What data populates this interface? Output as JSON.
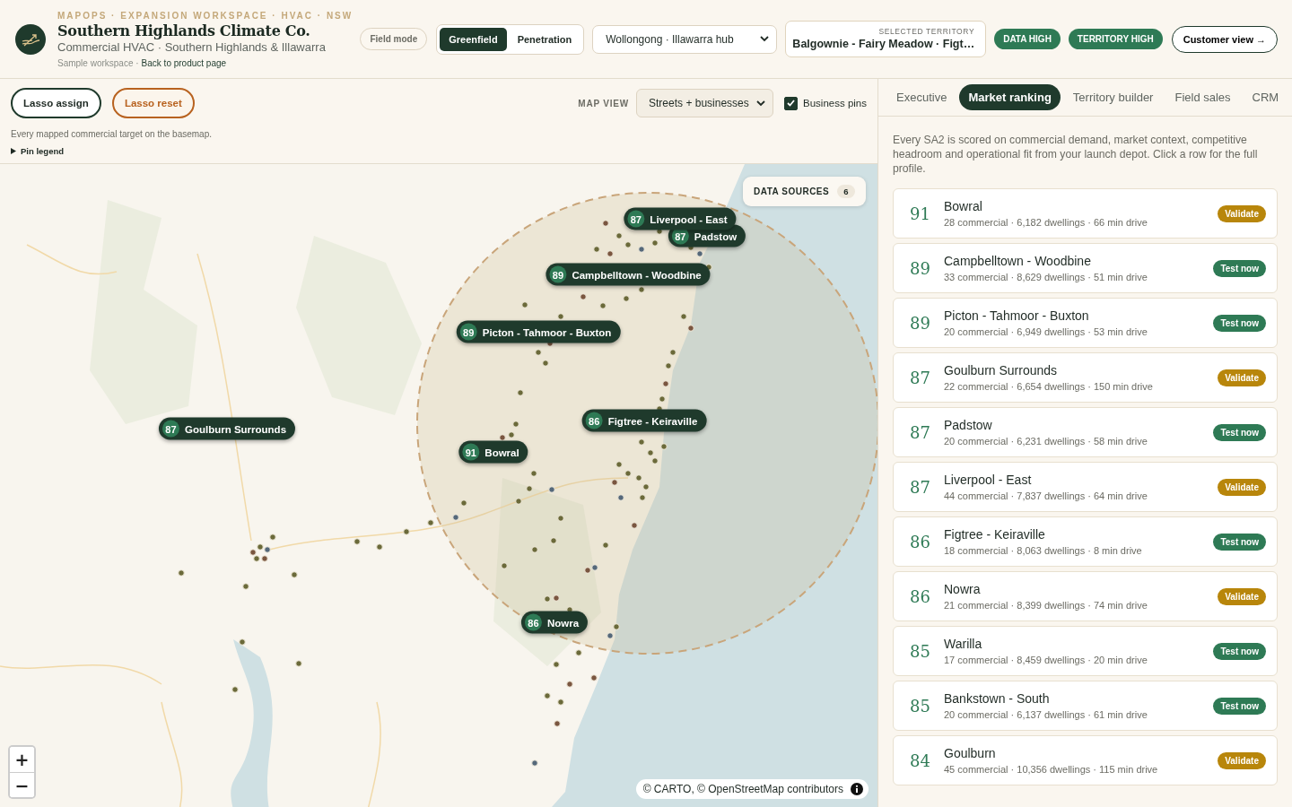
{
  "header": {
    "eyebrow": "MAPOPS · EXPANSION WORKSPACE · HVAC · NSW",
    "title": "Southern Highlands Climate Co.",
    "subtitle": "Commercial HVAC · Southern Highlands & Illawarra",
    "workspace_note": "Sample workspace ·",
    "back_link": "Back to product page",
    "field_mode": "Field mode",
    "modes": [
      {
        "label": "Greenfield",
        "selected": true
      },
      {
        "label": "Penetration",
        "selected": false
      }
    ],
    "hub_select": "Wollongong · Illawarra hub",
    "selected_territory": {
      "label": "SELECTED TERRITORY",
      "value": "Balgownie - Fairy Meadow · Figt…"
    },
    "pills": [
      "DATA HIGH",
      "TERRITORY HIGH"
    ],
    "customer_view": "Customer view →"
  },
  "map_toolbar": {
    "lasso_assign": "Lasso assign",
    "lasso_reset": "Lasso reset",
    "map_view_label": "MAP VIEW",
    "map_view": "Streets + businesses",
    "business_pins": {
      "label": "Business pins",
      "checked": true
    },
    "caption": "Every mapped commercial target on the basemap.",
    "pin_legend": {
      "label": "Pin legend",
      "expanded": false
    }
  },
  "map": {
    "data_sources": {
      "label": "DATA SOURCES",
      "count": "6"
    },
    "pins": [
      {
        "score": "87",
        "name": "Padstow"
      },
      {
        "score": "87",
        "name": "Liverpool - East"
      },
      {
        "score": "89",
        "name": "Campbelltown - Woodbine"
      },
      {
        "score": "89",
        "name": "Picton - Tahmoor - Buxton"
      },
      {
        "score": "87",
        "name": "Goulburn Surrounds"
      },
      {
        "score": "86",
        "name": "Figtree - Keiraville"
      },
      {
        "score": "91",
        "name": "Bowral"
      },
      {
        "score": "86",
        "name": "Nowra"
      }
    ],
    "zoom_controls": [
      "+",
      "−"
    ],
    "attribution": "© CARTO, © OpenStreetMap contributors"
  },
  "panel": {
    "tabs": [
      {
        "label": "Executive",
        "selected": false
      },
      {
        "label": "Market ranking",
        "selected": true
      },
      {
        "label": "Territory builder",
        "selected": false
      },
      {
        "label": "Field sales",
        "selected": false
      },
      {
        "label": "CRM",
        "selected": false
      }
    ],
    "intro": "Every SA2 is scored on commercial demand, market context, competitive headroom and operational fit from your launch depot. Click a row for the full profile.",
    "rows": [
      {
        "score": "91",
        "name": "Bowral",
        "details": "28 commercial · 6,182 dwellings · 66 min drive",
        "action": {
          "kind": "validate",
          "label": "Validate"
        }
      },
      {
        "score": "89",
        "name": "Campbelltown - Woodbine",
        "details": "33 commercial · 8,629 dwellings · 51 min drive",
        "action": {
          "kind": "test",
          "label": "Test now"
        }
      },
      {
        "score": "89",
        "name": "Picton - Tahmoor - Buxton",
        "details": "20 commercial · 6,949 dwellings · 53 min drive",
        "action": {
          "kind": "test",
          "label": "Test now"
        }
      },
      {
        "score": "87",
        "name": "Goulburn Surrounds",
        "details": "22 commercial · 6,654 dwellings · 150 min drive",
        "action": {
          "kind": "validate",
          "label": "Validate"
        }
      },
      {
        "score": "87",
        "name": "Padstow",
        "details": "20 commercial · 6,231 dwellings · 58 min drive",
        "action": {
          "kind": "test",
          "label": "Test now"
        }
      },
      {
        "score": "87",
        "name": "Liverpool - East",
        "details": "44 commercial · 7,837 dwellings · 64 min drive",
        "action": {
          "kind": "validate",
          "label": "Validate"
        }
      },
      {
        "score": "86",
        "name": "Figtree - Keiraville",
        "details": "18 commercial · 8,063 dwellings · 8 min drive",
        "action": {
          "kind": "test",
          "label": "Test now"
        }
      },
      {
        "score": "86",
        "name": "Nowra",
        "details": "21 commercial · 8,399 dwellings · 74 min drive",
        "action": {
          "kind": "validate",
          "label": "Validate"
        }
      },
      {
        "score": "85",
        "name": "Warilla",
        "details": "17 commercial · 8,459 dwellings · 20 min drive",
        "action": {
          "kind": "test",
          "label": "Test now"
        }
      },
      {
        "score": "85",
        "name": "Bankstown - South",
        "details": "20 commercial · 6,137 dwellings · 61 min drive",
        "action": {
          "kind": "test",
          "label": "Test now"
        }
      },
      {
        "score": "84",
        "name": "Goulburn",
        "details": "45 commercial · 10,356 dwellings · 115 min drive",
        "action": {
          "kind": "validate",
          "label": "Validate"
        }
      }
    ]
  }
}
